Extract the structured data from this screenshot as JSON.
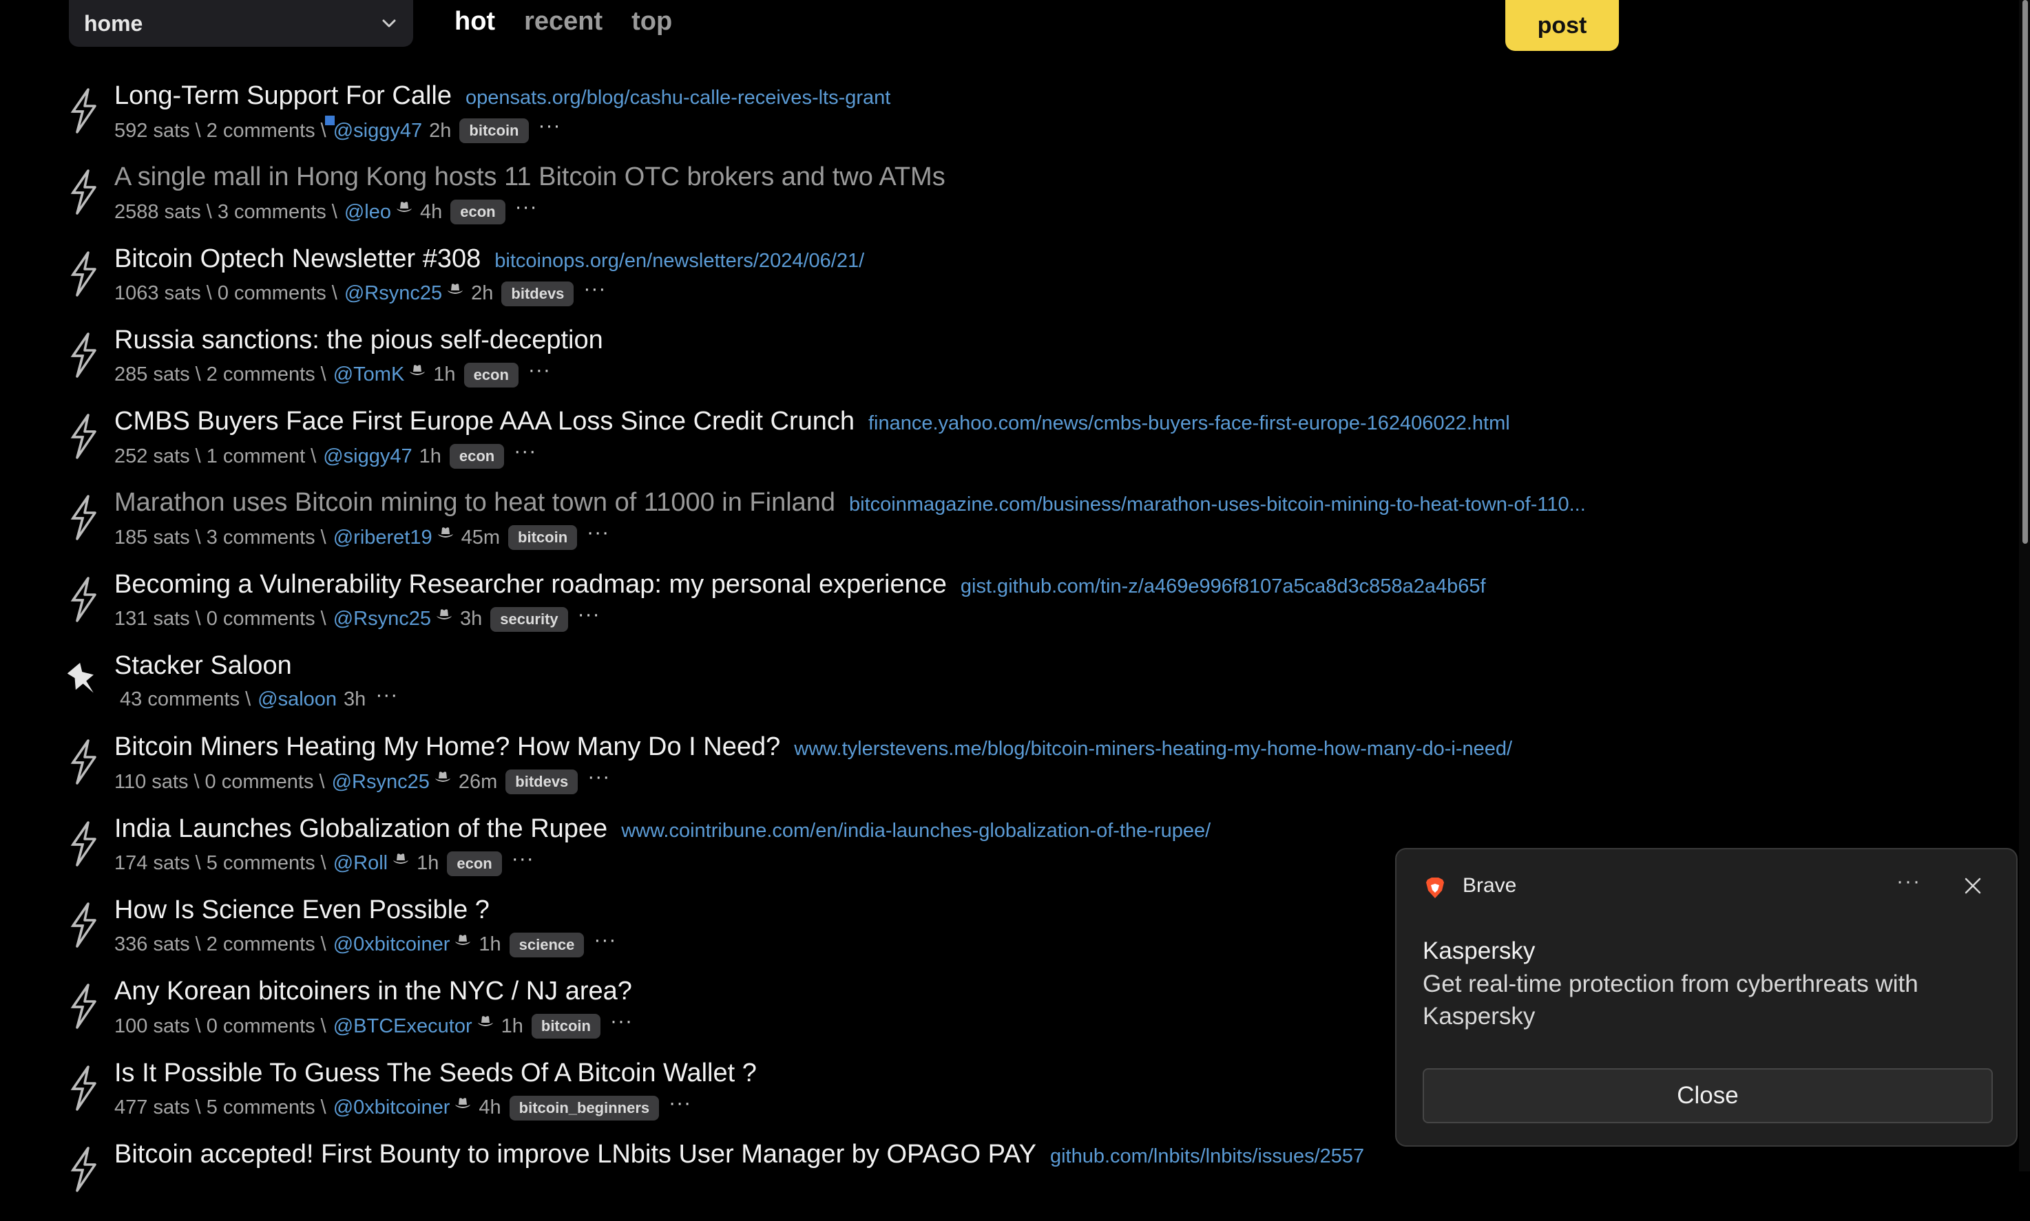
{
  "header": {
    "territory": "home",
    "tabs": [
      "hot",
      "recent",
      "top"
    ],
    "active_tab": "hot",
    "post_label": "post"
  },
  "items": [
    {
      "title": "Long-Term Support For Calle",
      "url": "opensats.org/blog/cashu-calle-receives-lts-grant",
      "sats": "592 sats",
      "comments": "2 comments",
      "user": "@siggy47",
      "cowboy": false,
      "age": "2h",
      "sub": "bitcoin",
      "visited": false,
      "pinned": false
    },
    {
      "title": "A single mall in Hong Kong hosts 11 Bitcoin OTC brokers and two ATMs",
      "url": "",
      "sats": "2588 sats",
      "comments": "3 comments",
      "user": "@leo",
      "cowboy": true,
      "age": "4h",
      "sub": "econ",
      "visited": true,
      "pinned": false
    },
    {
      "title": "Bitcoin Optech Newsletter #308",
      "url": "bitcoinops.org/en/newsletters/2024/06/21/",
      "sats": "1063 sats",
      "comments": "0 comments",
      "user": "@Rsync25",
      "cowboy": true,
      "age": "2h",
      "sub": "bitdevs",
      "visited": false,
      "pinned": false
    },
    {
      "title": "Russia sanctions: the pious self-deception",
      "url": "",
      "sats": "285 sats",
      "comments": "2 comments",
      "user": "@TomK",
      "cowboy": true,
      "age": "1h",
      "sub": "econ",
      "visited": false,
      "pinned": false
    },
    {
      "title": "CMBS Buyers Face First Europe AAA Loss Since Credit Crunch",
      "url": "finance.yahoo.com/news/cmbs-buyers-face-first-europe-162406022.html",
      "sats": "252 sats",
      "comments": "1 comment",
      "user": "@siggy47",
      "cowboy": false,
      "age": "1h",
      "sub": "econ",
      "visited": false,
      "pinned": false
    },
    {
      "title": "Marathon uses Bitcoin mining to heat town of 11000 in Finland",
      "url": "bitcoinmagazine.com/business/marathon-uses-bitcoin-mining-to-heat-town-of-110...",
      "sats": "185 sats",
      "comments": "3 comments",
      "user": "@riberet19",
      "cowboy": true,
      "age": "45m",
      "sub": "bitcoin",
      "visited": true,
      "pinned": false
    },
    {
      "title": "Becoming a Vulnerability Researcher roadmap: my personal experience",
      "url": "gist.github.com/tin-z/a469e996f8107a5ca8d3c858a2a4b65f",
      "sats": "131 sats",
      "comments": "0 comments",
      "user": "@Rsync25",
      "cowboy": true,
      "age": "3h",
      "sub": "security",
      "visited": false,
      "pinned": false
    },
    {
      "title": "Stacker Saloon",
      "url": "",
      "sats": "",
      "comments": "43 comments",
      "user": "@saloon",
      "cowboy": false,
      "age": "3h",
      "sub": "",
      "visited": false,
      "pinned": true
    },
    {
      "title": "Bitcoin Miners Heating My Home? How Many Do I Need?",
      "url": "www.tylerstevens.me/blog/bitcoin-miners-heating-my-home-how-many-do-i-need/",
      "sats": "110 sats",
      "comments": "0 comments",
      "user": "@Rsync25",
      "cowboy": true,
      "age": "26m",
      "sub": "bitdevs",
      "visited": false,
      "pinned": false
    },
    {
      "title": "India Launches Globalization of the Rupee",
      "url": "www.cointribune.com/en/india-launches-globalization-of-the-rupee/",
      "sats": "174 sats",
      "comments": "5 comments",
      "user": "@Roll",
      "cowboy": true,
      "age": "1h",
      "sub": "econ",
      "visited": false,
      "pinned": false
    },
    {
      "title": "How Is Science Even Possible ?",
      "url": "",
      "sats": "336 sats",
      "comments": "2 comments",
      "user": "@0xbitcoiner",
      "cowboy": true,
      "age": "1h",
      "sub": "science",
      "visited": false,
      "pinned": false
    },
    {
      "title": "Any Korean bitcoiners in the NYC / NJ area?",
      "url": "",
      "sats": "100 sats",
      "comments": "0 comments",
      "user": "@BTCExecutor",
      "cowboy": true,
      "age": "1h",
      "sub": "bitcoin",
      "visited": false,
      "pinned": false
    },
    {
      "title": "Is It Possible To Guess The Seeds Of A Bitcoin Wallet ?",
      "url": "",
      "sats": "477 sats",
      "comments": "5 comments",
      "user": "@0xbitcoiner",
      "cowboy": true,
      "age": "4h",
      "sub": "bitcoin_beginners",
      "visited": false,
      "pinned": false
    },
    {
      "title": "Bitcoin accepted! First Bounty to improve LNbits User Manager by OPAGO PAY",
      "url": "github.com/lnbits/lnbits/issues/2557",
      "sats": "",
      "comments": "",
      "user": "",
      "cowboy": false,
      "age": "",
      "sub": "",
      "visited": false,
      "pinned": false
    }
  ],
  "notification": {
    "app": "Brave",
    "title": "Kaspersky",
    "body": "Get real-time protection from cyberthreats with Kaspersky",
    "button": "Close"
  },
  "colors": {
    "background": "#000000",
    "link": "#5b9bd5",
    "post_button": "#f5d547",
    "badge": "#3c3c3e"
  },
  "icons": {
    "zap": "lightning-bolt-icon",
    "pin": "pin-icon",
    "cowboy": "cowboy-hat-icon",
    "chevron": "chevron-down-icon",
    "close": "close-icon",
    "brave": "brave-lion-icon"
  }
}
